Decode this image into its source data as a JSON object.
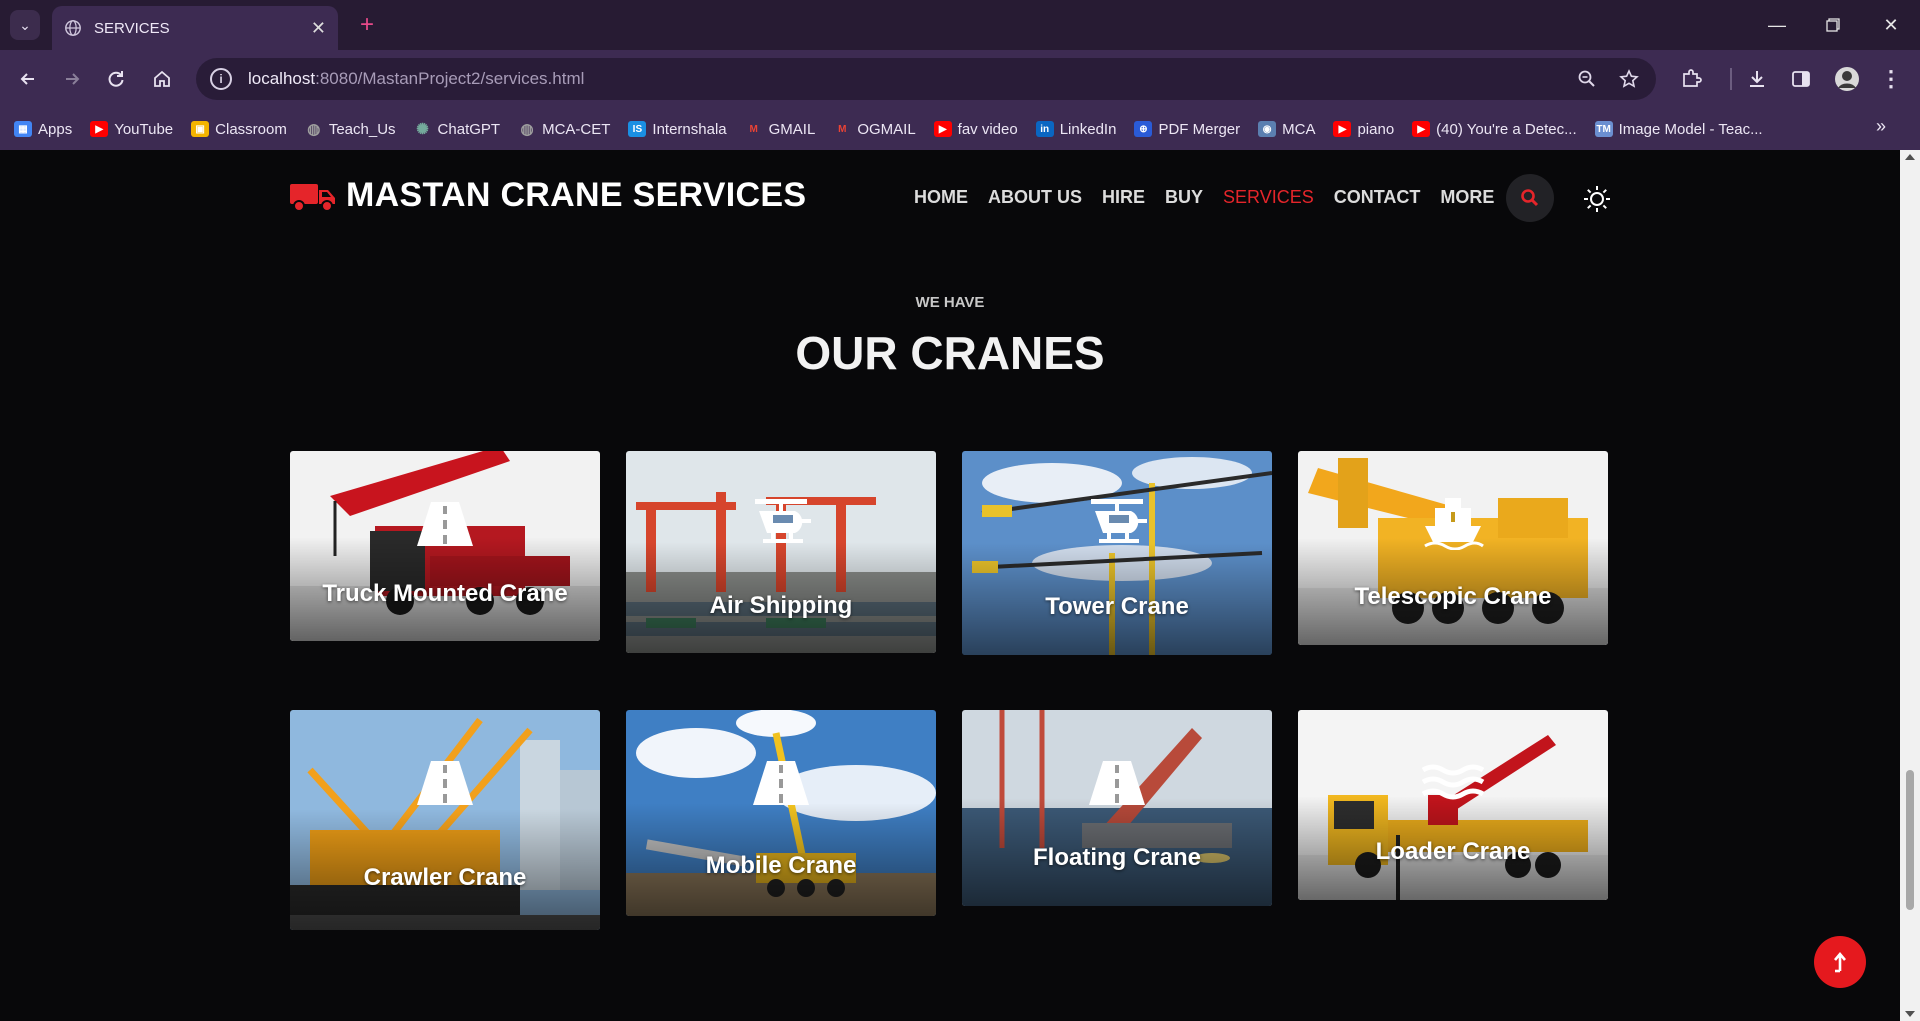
{
  "browser": {
    "tab_title": "SERVICES",
    "url_host": "localhost",
    "url_rest": ":8080/MastanProject2/services.html",
    "bookmarks": [
      {
        "label": "Apps",
        "icon": "apps-grid-icon",
        "color": "#4285f4"
      },
      {
        "label": "YouTube",
        "icon": "youtube-icon",
        "color": "#ff0000"
      },
      {
        "label": "Classroom",
        "icon": "classroom-icon",
        "color": "#f4b400"
      },
      {
        "label": "Teach_Us",
        "icon": "globe-icon",
        "color": "#9e9e9e"
      },
      {
        "label": "ChatGPT",
        "icon": "chatgpt-icon",
        "color": "#74aa9c"
      },
      {
        "label": "MCA-CET",
        "icon": "globe-icon",
        "color": "#9e9e9e"
      },
      {
        "label": "Internshala",
        "icon": "internshala-icon",
        "color": "#1a8fe3"
      },
      {
        "label": "GMAIL",
        "icon": "gmail-icon",
        "color": "#ea4335"
      },
      {
        "label": "OGMAIL",
        "icon": "gmail-icon",
        "color": "#ea4335"
      },
      {
        "label": "fav video",
        "icon": "youtube-icon",
        "color": "#ff0000"
      },
      {
        "label": "LinkedIn",
        "icon": "linkedin-icon",
        "color": "#0a66c2"
      },
      {
        "label": "PDF Merger",
        "icon": "pdf-merger-icon",
        "color": "#2a5bd7"
      },
      {
        "label": "MCA",
        "icon": "mca-icon",
        "color": "#5b7fb0"
      },
      {
        "label": "piano",
        "icon": "youtube-icon",
        "color": "#ff0000"
      },
      {
        "label": "(40) You're a Detec...",
        "icon": "youtube-icon",
        "color": "#ff0000"
      },
      {
        "label": "Image Model - Teac...",
        "icon": "tm-icon",
        "color": "#6b8fd1"
      }
    ]
  },
  "site": {
    "brand": "MASTAN CRANE SERVICES",
    "accent": "#e5252a",
    "menu": [
      {
        "label": "HOME",
        "active": false
      },
      {
        "label": "ABOUT US",
        "active": false
      },
      {
        "label": "HIRE",
        "active": false
      },
      {
        "label": "BUY",
        "active": false
      },
      {
        "label": "SERVICES",
        "active": true
      },
      {
        "label": "CONTACT",
        "active": false
      },
      {
        "label": "MORE",
        "active": false
      }
    ],
    "eyebrow": "WE HAVE",
    "heading": "OUR CRANES",
    "cards": [
      {
        "label": "Truck Mounted Crane",
        "icon": "road-icon"
      },
      {
        "label": "Air Shipping",
        "icon": "helicopter-icon"
      },
      {
        "label": "Tower Crane",
        "icon": "helicopter-icon"
      },
      {
        "label": "Telescopic Crane",
        "icon": "ship-icon"
      },
      {
        "label": "Crawler Crane",
        "icon": "road-icon"
      },
      {
        "label": "Mobile Crane",
        "icon": "road-icon"
      },
      {
        "label": "Floating Crane",
        "icon": "road-icon"
      },
      {
        "label": "Loader Crane",
        "icon": "water-icon"
      }
    ]
  }
}
